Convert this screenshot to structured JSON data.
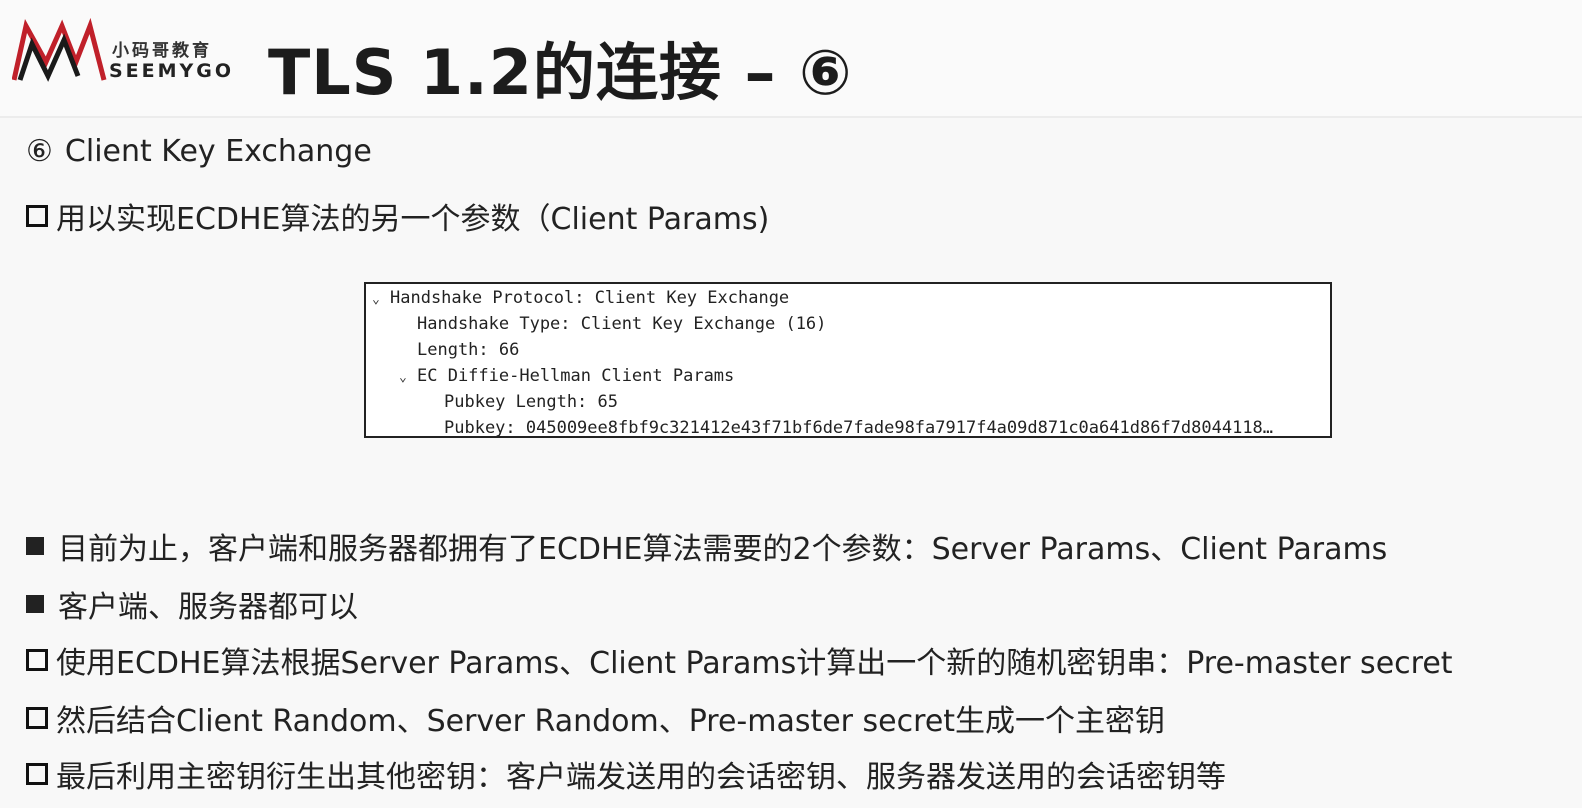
{
  "header": {
    "logo_cn": "小码哥教育",
    "logo_en": "SEEMYGO",
    "title": "TLS 1.2的连接 – ⑥"
  },
  "section": {
    "step_marker": "⑥",
    "step_label": "Client Key Exchange",
    "intro": "用以实现ECDHE算法的另一个参数（Client Params)"
  },
  "packet_tree": [
    {
      "indent": 0,
      "expanded": true,
      "text": "Handshake Protocol: Client Key Exchange"
    },
    {
      "indent": 1,
      "expanded": null,
      "text": "Handshake Type: Client Key Exchange (16)"
    },
    {
      "indent": 1,
      "expanded": null,
      "text": "Length: 66"
    },
    {
      "indent": 1,
      "expanded": true,
      "text": "EC Diffie-Hellman Client Params"
    },
    {
      "indent": 2,
      "expanded": null,
      "text": "Pubkey Length: 65"
    },
    {
      "indent": 2,
      "expanded": null,
      "text": "Pubkey: 045009ee8fbf9c321412e43f71bf6de7fade98fa7917f4a09d871c0a641d86f7d8044118…"
    }
  ],
  "points": [
    {
      "style": "filled",
      "text": "目前为止，客户端和服务器都拥有了ECDHE算法需要的2个参数：Server Params、Client Params"
    },
    {
      "style": "filled",
      "text": "客户端、服务器都可以"
    },
    {
      "style": "hollow",
      "text": "使用ECDHE算法根据Server Params、Client Params计算出一个新的随机密钥串：Pre-master secret"
    },
    {
      "style": "hollow",
      "text": "然后结合Client Random、Server Random、Pre-master secret生成一个主密钥"
    },
    {
      "style": "hollow",
      "text": "最后利用主密钥衍生出其他密钥：客户端发送用的会话密钥、服务器发送用的会话密钥等"
    }
  ],
  "colors": {
    "logo_red": "#c0202a",
    "text": "#222222"
  }
}
